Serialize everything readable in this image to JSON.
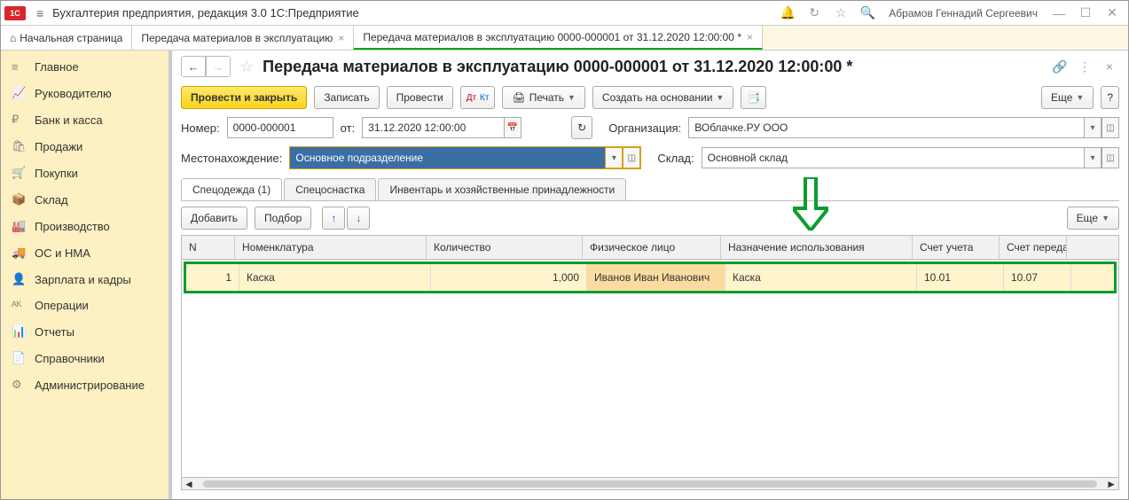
{
  "titlebar": {
    "app_title": "Бухгалтерия предприятия, редакция 3.0 1С:Предприятие",
    "user": "Абрамов Геннадий Сергеевич"
  },
  "tabs": {
    "home": "Начальная страница",
    "t1": "Передача материалов в эксплуатацию",
    "t2": "Передача материалов в эксплуатацию 0000-000001 от 31.12.2020 12:00:00 *"
  },
  "sidebar": [
    {
      "icon": "≡",
      "label": "Главное"
    },
    {
      "icon": "📈",
      "label": "Руководителю"
    },
    {
      "icon": "₽",
      "label": "Банк и касса"
    },
    {
      "icon": "🛍",
      "label": "Продажи"
    },
    {
      "icon": "🛒",
      "label": "Покупки"
    },
    {
      "icon": "📦",
      "label": "Склад"
    },
    {
      "icon": "🏭",
      "label": "Производство"
    },
    {
      "icon": "🚚",
      "label": "ОС и НМА"
    },
    {
      "icon": "👤",
      "label": "Зарплата и кадры"
    },
    {
      "icon": "ᴬᴷ",
      "label": "Операции"
    },
    {
      "icon": "📊",
      "label": "Отчеты"
    },
    {
      "icon": "📄",
      "label": "Справочники"
    },
    {
      "icon": "⚙",
      "label": "Администрирование"
    }
  ],
  "doc": {
    "title": "Передача материалов в эксплуатацию 0000-000001 от 31.12.2020 12:00:00 *",
    "btn_post_close": "Провести и закрыть",
    "btn_save": "Записать",
    "btn_post": "Провести",
    "btn_print": "Печать",
    "btn_based": "Создать на основании",
    "btn_more": "Еще",
    "number_label": "Номер:",
    "number": "0000-000001",
    "from_label": "от:",
    "date": "31.12.2020 12:00:00",
    "org_label": "Организация:",
    "org": "ВОблачке.РУ ООО",
    "loc_label": "Местонахождение:",
    "loc": "Основное подразделение",
    "wh_label": "Склад:",
    "wh": "Основной склад"
  },
  "subtabs": {
    "t1": "Спецодежда (1)",
    "t2": "Спецоснастка",
    "t3": "Инвентарь и хозяйственные принадлежности"
  },
  "subtoolbar": {
    "add": "Добавить",
    "select": "Подбор",
    "more": "Еще"
  },
  "table": {
    "head": {
      "n": "N",
      "nom": "Номенклатура",
      "qty": "Количество",
      "person": "Физическое лицо",
      "usage": "Назначение использования",
      "acc": "Счет учета",
      "acc2": "Счет переда"
    },
    "row": {
      "n": "1",
      "nom": "Каска",
      "qty": "1,000",
      "person": "Иванов Иван Иванович",
      "usage": "Каска",
      "acc": "10.01",
      "acc2": "10.07"
    }
  }
}
